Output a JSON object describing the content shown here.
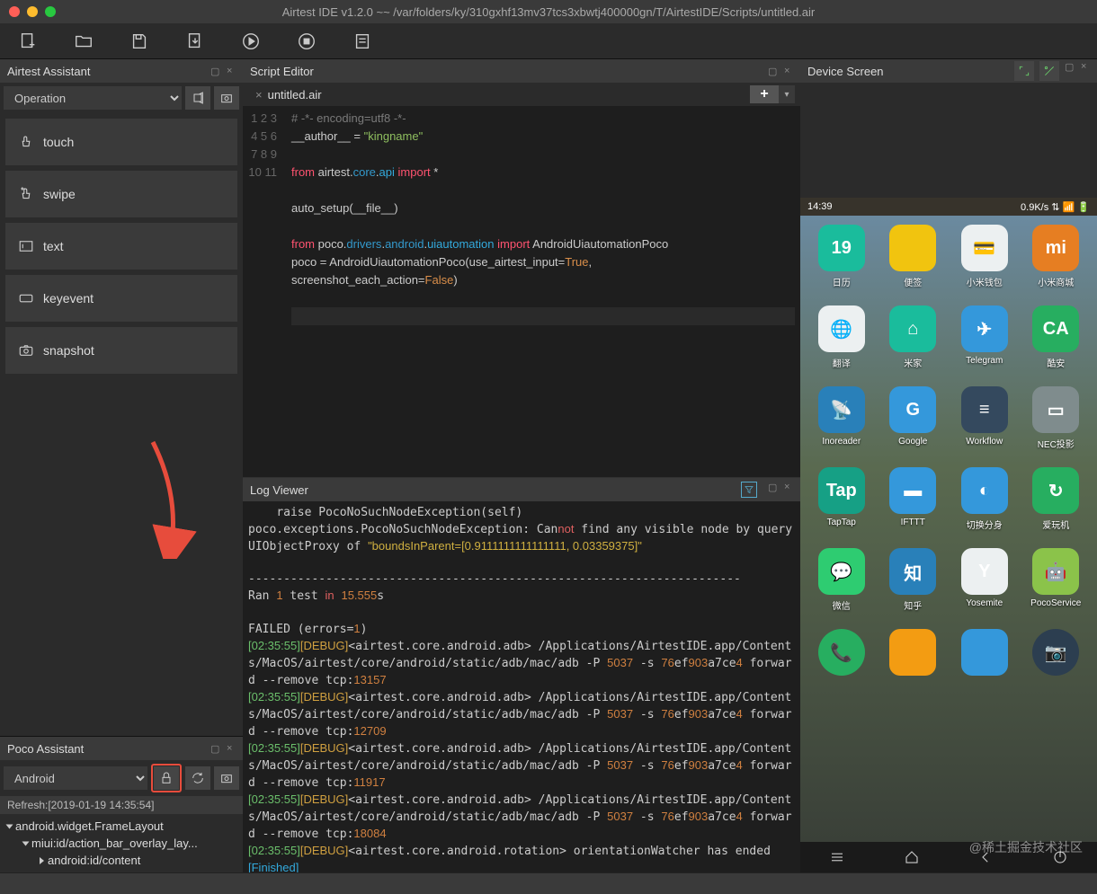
{
  "window": {
    "title": "Airtest IDE v1.2.0 ~~ /var/folders/ky/310gxhf13mv37tcs3xbwtj400000gn/T/AirtestIDE/Scripts/untitled.air"
  },
  "panels": {
    "assistant": "Airtest Assistant",
    "poco": "Poco Assistant",
    "script": "Script Editor",
    "log": "Log Viewer",
    "device": "Device Screen"
  },
  "assistant": {
    "operation": "Operation",
    "actions": [
      "touch",
      "swipe",
      "text",
      "keyevent",
      "snapshot"
    ]
  },
  "poco": {
    "platform": "Android",
    "refresh": "Refresh:[2019-01-19 14:35:54]",
    "tree": [
      {
        "indent": 0,
        "open": true,
        "label": "android.widget.FrameLayout"
      },
      {
        "indent": 1,
        "open": true,
        "label": "miui:id/action_bar_overlay_lay..."
      },
      {
        "indent": 2,
        "open": false,
        "label": "android:id/content"
      }
    ]
  },
  "editor": {
    "tab": "untitled.air",
    "plus": "+",
    "code_lines": [
      {
        "n": 1,
        "html": "<span class='c-comment'># -*- encoding=utf8 -*-</span>"
      },
      {
        "n": 2,
        "html": "__author__ = <span class='c-str'>\"kingname\"</span>"
      },
      {
        "n": 3,
        "html": ""
      },
      {
        "n": 4,
        "html": "<span class='c-kw'>from</span> airtest.<span class='c-mod'>core</span>.<span class='c-fn'>api</span> <span class='c-kw'>import</span> *"
      },
      {
        "n": 5,
        "html": ""
      },
      {
        "n": 6,
        "html": "auto_setup(__file__)"
      },
      {
        "n": 7,
        "html": ""
      },
      {
        "n": 8,
        "html": "<span class='c-kw'>from</span> poco.<span class='c-mod'>drivers</span>.<span class='c-mod'>android</span>.<span class='c-fn'>uiautomation</span> <span class='c-kw'>import</span> AndroidUiautomationPoco"
      },
      {
        "n": 9,
        "html": "poco = AndroidUiautomationPoco(use_airtest_input=<span class='c-bool'>True</span>,"
      },
      {
        "n": 10,
        "html": "screenshot_each_action=<span class='c-bool'>False</span>)",
        "indent": "        "
      },
      {
        "n": 10,
        "skip": true
      },
      {
        "n": 11,
        "html": "<span class='cursor-line'> </span>"
      }
    ],
    "real_lines": [
      1,
      2,
      3,
      4,
      5,
      6,
      7,
      8,
      9,
      10,
      11
    ]
  },
  "log": {
    "lines": [
      "    raise PocoNoSuchNodeException(self)",
      "poco.exceptions.PocoNoSuchNodeException: Can<span class='l-red'>not</span> find any visible node by query UIObjectProxy of <span class='l-str'>\"boundsInParent=[0.9111111111111111, 0.03359375]\"</span>",
      "",
      "----------------------------------------------------------------------",
      "Ran <span class='l-num'>1</span> test <span class='l-red'>in</span> <span class='l-num'>15.555</span>s",
      "",
      "FAILED (errors=<span class='l-num'>1</span>)",
      "<span class='l-ts'>[02:35:55]</span><span class='l-dbg'>[DEBUG]</span>&lt;airtest.core.android.adb&gt; /Applications/AirtestIDE.app/Contents/MacOS/airtest/core/android/static/adb/mac/adb -P <span class='l-num'>5037</span> -s <span class='l-num'>76</span>ef<span class='l-num'>903</span>a7ce<span class='l-num'>4</span> forward --remove tcp:<span class='l-num'>13157</span>",
      "<span class='l-ts'>[02:35:55]</span><span class='l-dbg'>[DEBUG]</span>&lt;airtest.core.android.adb&gt; /Applications/AirtestIDE.app/Contents/MacOS/airtest/core/android/static/adb/mac/adb -P <span class='l-num'>5037</span> -s <span class='l-num'>76</span>ef<span class='l-num'>903</span>a7ce<span class='l-num'>4</span> forward --remove tcp:<span class='l-num'>12709</span>",
      "<span class='l-ts'>[02:35:55]</span><span class='l-dbg'>[DEBUG]</span>&lt;airtest.core.android.adb&gt; /Applications/AirtestIDE.app/Contents/MacOS/airtest/core/android/static/adb/mac/adb -P <span class='l-num'>5037</span> -s <span class='l-num'>76</span>ef<span class='l-num'>903</span>a7ce<span class='l-num'>4</span> forward --remove tcp:<span class='l-num'>11917</span>",
      "<span class='l-ts'>[02:35:55]</span><span class='l-dbg'>[DEBUG]</span>&lt;airtest.core.android.adb&gt; /Applications/AirtestIDE.app/Contents/MacOS/airtest/core/android/static/adb/mac/adb -P <span class='l-num'>5037</span> -s <span class='l-num'>76</span>ef<span class='l-num'>903</span>a7ce<span class='l-num'>4</span> forward --remove tcp:<span class='l-num'>18084</span>",
      "<span class='l-ts'>[02:35:55]</span><span class='l-dbg'>[DEBUG]</span>&lt;airtest.core.android.rotation&gt; orientationWatcher has ended",
      "<span class='l-cy'>[Finished]</span>",
      "",
      "=============================================================="
    ]
  },
  "device": {
    "time": "14:39",
    "status_right": "0.9K/s ⇅ 📶 🔋",
    "apps": [
      {
        "label": "日历",
        "bg": "#1abc9c",
        "txt": "19"
      },
      {
        "label": "便签",
        "bg": "#f1c40f",
        "txt": ""
      },
      {
        "label": "小米钱包",
        "bg": "#ecf0f1",
        "txt": "💳"
      },
      {
        "label": "小米商城",
        "bg": "#e67e22",
        "txt": "mi"
      },
      {
        "label": "翻译",
        "bg": "#ecf0f1",
        "txt": "🌐"
      },
      {
        "label": "米家",
        "bg": "#1abc9c",
        "txt": "⌂"
      },
      {
        "label": "Telegram",
        "bg": "#3498db",
        "txt": "✈"
      },
      {
        "label": "酷安",
        "bg": "#27ae60",
        "txt": "CA"
      },
      {
        "label": "Inoreader",
        "bg": "#2980b9",
        "txt": "📡"
      },
      {
        "label": "Google",
        "bg": "#3498db",
        "txt": "G"
      },
      {
        "label": "Workflow",
        "bg": "#34495e",
        "txt": "≡"
      },
      {
        "label": "NEC投影",
        "bg": "#7f8c8d",
        "txt": "▭"
      },
      {
        "label": "TapTap",
        "bg": "#16a085",
        "txt": "Tap"
      },
      {
        "label": "IFTTT",
        "bg": "#3498db",
        "txt": "▬"
      },
      {
        "label": "切换分身",
        "bg": "#3498db",
        "txt": "◐"
      },
      {
        "label": "爱玩机",
        "bg": "#27ae60",
        "txt": "↻"
      },
      {
        "label": "微信",
        "bg": "#2ecc71",
        "txt": "💬"
      },
      {
        "label": "知乎",
        "bg": "#2980b9",
        "txt": "知"
      },
      {
        "label": "Yosemite",
        "bg": "#ecf0f1",
        "txt": "Y"
      },
      {
        "label": "PocoService",
        "bg": "#8bc34a",
        "txt": "🤖"
      },
      {
        "label": "",
        "bg": "#27ae60",
        "txt": "📞",
        "round": true
      },
      {
        "label": "",
        "bg": "#f39c12",
        "txt": ""
      },
      {
        "label": "",
        "bg": "#3498db",
        "txt": ""
      },
      {
        "label": "",
        "bg": "#2c3e50",
        "txt": "📷",
        "round": true
      }
    ]
  },
  "watermark": "@稀土掘金技术社区"
}
